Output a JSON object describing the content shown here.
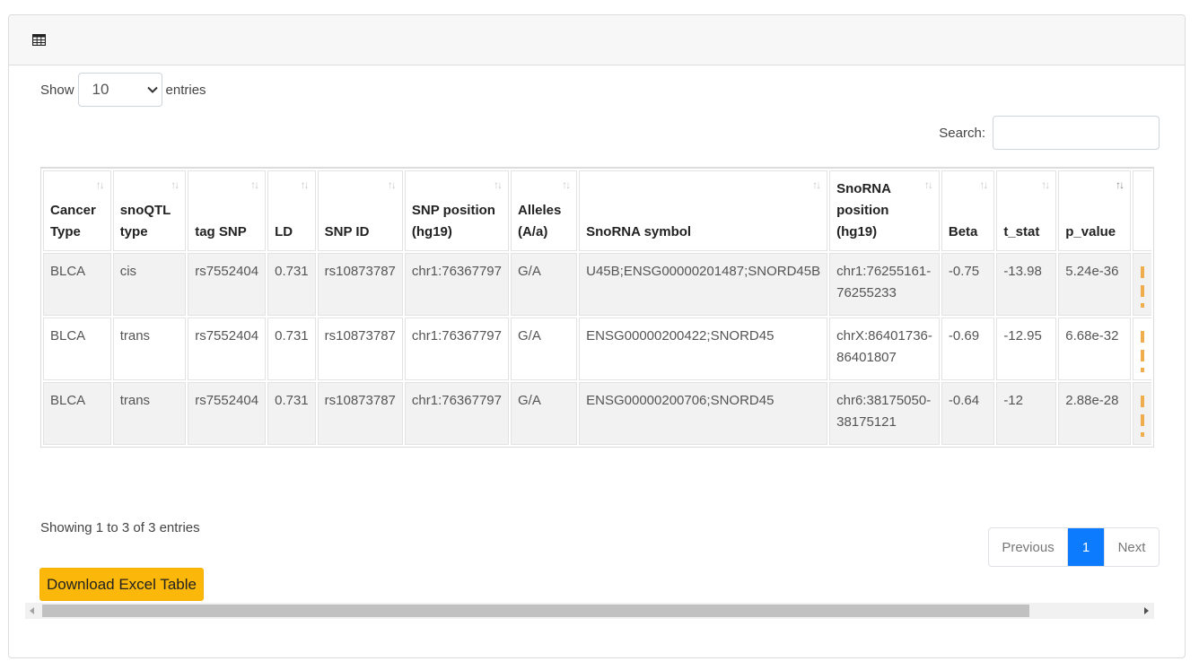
{
  "length": {
    "show_label": "Show",
    "value": "10",
    "entries_label": "entries"
  },
  "search": {
    "label": "Search:",
    "placeholder": "",
    "value": ""
  },
  "table": {
    "columns": [
      "Cancer Type",
      "snoQTL type",
      "tag SNP",
      "LD",
      "SNP ID",
      "SNP position (hg19)",
      "Alleles (A/a)",
      "SnoRNA symbol",
      "SnoRNA position (hg19)",
      "Beta",
      "t_stat",
      "p_value"
    ],
    "rows": [
      [
        "BLCA",
        "cis",
        "rs7552404",
        "0.731",
        "rs10873787",
        "chr1:76367797",
        "G/A",
        "U45B;ENSG00000201487;SNORD45B",
        "chr1:76255161-76255233",
        "-0.75",
        "-13.98",
        "5.24e-36"
      ],
      [
        "BLCA",
        "trans",
        "rs7552404",
        "0.731",
        "rs10873787",
        "chr1:76367797",
        "G/A",
        "ENSG00000200422;SNORD45",
        "chrX:86401736-86401807",
        "-0.69",
        "-12.95",
        "6.68e-32"
      ],
      [
        "BLCA",
        "trans",
        "rs7552404",
        "0.731",
        "rs10873787",
        "chr1:76367797",
        "G/A",
        "ENSG00000200706;SNORD45",
        "chr6:38175050-38175121",
        "-0.64",
        "-12",
        "2.88e-28"
      ]
    ]
  },
  "info": "Showing 1 to 3 of 3 entries",
  "pagination": {
    "previous": "Previous",
    "current": "1",
    "next": "Next"
  },
  "download_label": "Download Excel Table",
  "icons": {
    "header": "table-icon",
    "sort": "sort-icon",
    "dropdown": "chevron-down-icon"
  },
  "colors": {
    "accent": "#0d7bfd",
    "button": "#fbb80a",
    "truncated_column": "#f0ad4e"
  }
}
